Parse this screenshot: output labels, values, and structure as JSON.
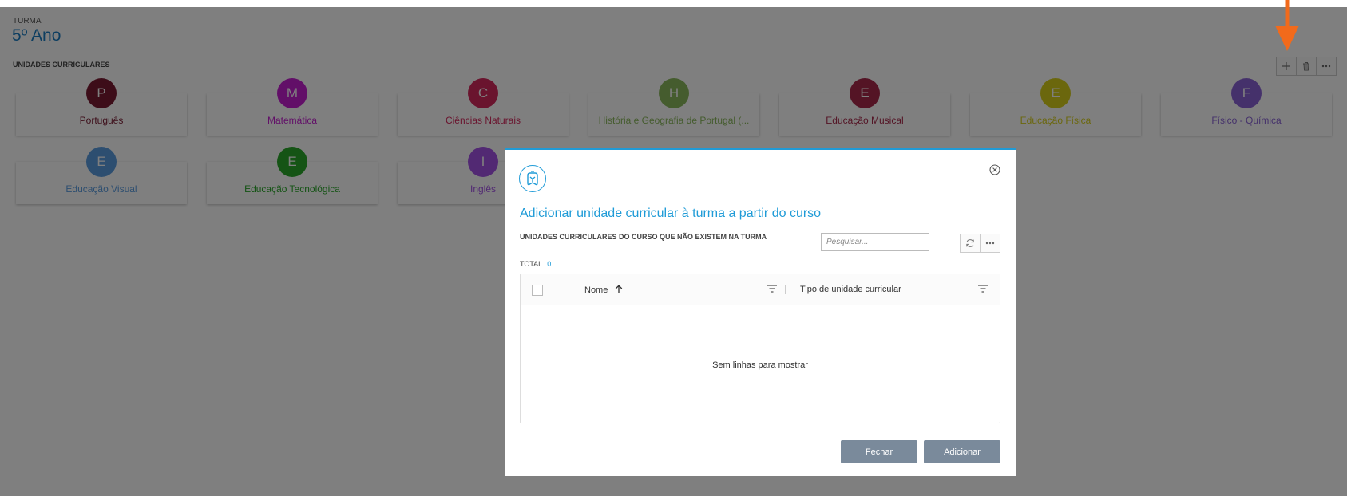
{
  "header": {
    "turma_label": "TURMA",
    "turma_value": "5º Ano",
    "section_label": "UNIDADES CURRICULARES"
  },
  "toolbar": {
    "add_icon": "plus-icon",
    "delete_icon": "trash-icon",
    "more_icon": "ellipsis-icon"
  },
  "units": [
    {
      "initial": "P",
      "name": "Português",
      "color": "#7a1b33"
    },
    {
      "initial": "M",
      "name": "Matemática",
      "color": "#c41fd1"
    },
    {
      "initial": "C",
      "name": "Ciências Naturais",
      "color": "#d4285d"
    },
    {
      "initial": "H",
      "name": "História e Geografia de Portugal (...",
      "color": "#8ab85c"
    },
    {
      "initial": "E",
      "name": "Educação Musical",
      "color": "#a8294b"
    },
    {
      "initial": "E",
      "name": "Educação Física",
      "color": "#d6cf1a"
    },
    {
      "initial": "F",
      "name": "Físico - Química",
      "color": "#8a63d6"
    },
    {
      "initial": "E",
      "name": "Educação Visual",
      "color": "#5b9de0"
    },
    {
      "initial": "E",
      "name": "Educação Tecnológica",
      "color": "#2aa82a"
    },
    {
      "initial": "I",
      "name": "Inglês",
      "color": "#a453e6"
    }
  ],
  "modal": {
    "title": "Adicionar unidade curricular à turma a partir do curso",
    "subtitle": "UNIDADES CURRICULARES DO CURSO QUE NÃO EXISTEM NA TURMA",
    "search_placeholder": "Pesquisar...",
    "total_label": "TOTAL",
    "total_value": "0",
    "columns": [
      "Nome",
      "Tipo de unidade curricular"
    ],
    "empty_text": "Sem linhas para mostrar",
    "close_label": "Fechar",
    "add_label": "Adicionar"
  },
  "colors": {
    "accent": "#1f9bd7",
    "arrow": "#f26a1b",
    "button": "#7a8a9b"
  }
}
